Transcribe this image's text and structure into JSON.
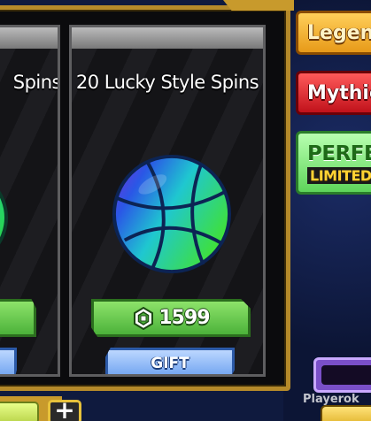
{
  "shop": {
    "left_card": {
      "title": "Spins"
    },
    "main_card": {
      "title": "20 Lucky Style Spins",
      "price": "1599",
      "price_currency_icon": "robux-icon",
      "gift_label": "GIFT",
      "item_icon": "basketball-icon"
    }
  },
  "side_tabs": {
    "legendary": "Legend",
    "mythic": "Mythic",
    "perfect_title": "PERFEC",
    "perfect_subtitle": "LIMITED TI"
  },
  "bottom": {
    "add_label": "+"
  },
  "watermark": "Playerok",
  "colors": {
    "frame_gold": "#b58a2a",
    "price_green": "#4cb23a",
    "gift_blue": "#6fa3f0",
    "legendary_orange": "#e79a19",
    "mythic_red": "#c1121b",
    "perfect_green": "#5ed45a"
  }
}
